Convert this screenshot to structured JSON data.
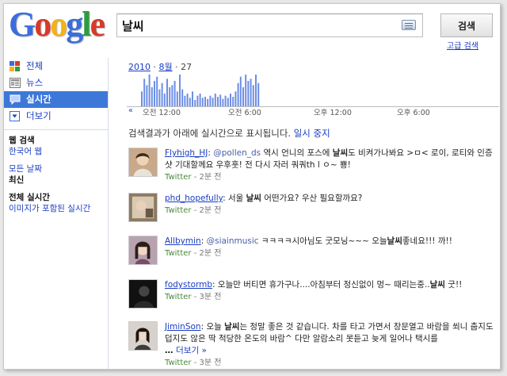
{
  "logo": {
    "text": "Google"
  },
  "search": {
    "query": "날씨",
    "button_label": "검색",
    "advanced_link": "고급 검색"
  },
  "sidebar": {
    "nav": [
      {
        "label": "전체",
        "icon": "all-results-icon"
      },
      {
        "label": "뉴스",
        "icon": "news-icon"
      },
      {
        "label": "실시간",
        "icon": "realtime-icon",
        "active": true
      },
      {
        "label": "더보기",
        "icon": "more-dropdown-icon"
      }
    ],
    "web_heading": "웹 검색",
    "web_korean": "한국어 웹",
    "all_dates": "모든 날짜",
    "latest": "최신",
    "realtime_heading": "전체 실시간",
    "images_realtime": "이미지가 포함된 실시간"
  },
  "timeline": {
    "year": "2010",
    "sep": "·",
    "month": "8월",
    "day": "27",
    "nav_symbol": "«",
    "labels": [
      "오전 12:00",
      "오전 6:00",
      "오후 12:00",
      "오후 6:00"
    ],
    "histogram": [
      14,
      26,
      20,
      30,
      18,
      24,
      28,
      16,
      22,
      12,
      26,
      18,
      20,
      24,
      14,
      30,
      16,
      10,
      12,
      8,
      14,
      6,
      10,
      12,
      8,
      9,
      7,
      10,
      8,
      12,
      9,
      11,
      7,
      10,
      8,
      12,
      9,
      14,
      22,
      28,
      18,
      30,
      24,
      26,
      20,
      30,
      22
    ],
    "bar_color": "#6b8ee6"
  },
  "notice": {
    "text": "검색결과가 아래에 실시간으로 표시됩니다.",
    "pause_link": "일시 중지"
  },
  "results": [
    {
      "user": "Flyhigh_HJ",
      "sep": ":",
      "mention": "@pollen_ds",
      "pre": " 역시 언니의 포스에 ",
      "keyword": "날씨",
      "post": "도 비켜가나봐요 >ㅁ< 로이, 로티와 인증샷 기대할께요 우후훗! 전 다시 자러 쿼쿼th l ㅇ~ 뿅!",
      "source": "Twitter",
      "dash": " - ",
      "time": "2분 전"
    },
    {
      "user": "phd_hopefully",
      "sep": ":",
      "mention": "",
      "pre": " 서울 ",
      "keyword": "날씨",
      "post": " 어떤가요? 우산 필요할까요?",
      "source": "Twitter",
      "dash": " - ",
      "time": "2분 전"
    },
    {
      "user": "Allbymin",
      "sep": ":",
      "mention": "@siainmusic",
      "pre": " ㅋㅋㅋㅋ시아님도 굿모닝~~~ 오늘",
      "keyword": "날씨",
      "post": "좋네요!!! 까!!",
      "source": "Twitter",
      "dash": " - ",
      "time": "2분 전"
    },
    {
      "user": "fodystormb",
      "sep": ":",
      "mention": "",
      "pre": " 오늘만 버티면 휴가구나....아침부터 정신없이 멍~ 때리는중..",
      "keyword": "날씨",
      "post": " 굿!!",
      "source": "Twitter",
      "dash": " - ",
      "time": "3분 전"
    },
    {
      "user": "JiminSon",
      "sep": ":",
      "mention": "",
      "pre": " 오늘 ",
      "keyword": "날씨",
      "post": "는 정말 좋은 것 같습니다. 차를 타고 가면서 창문열고 바람을 쐬니 춥지도 덥지도 않은 딱 적당한 온도의 바람^ 다만 알람소리 못듣고 늦게 일어나 택시를",
      "ellipsis": "… ",
      "more_link": "더보기 »",
      "source": "Twitter",
      "dash": " - ",
      "time": "3분 전"
    }
  ]
}
